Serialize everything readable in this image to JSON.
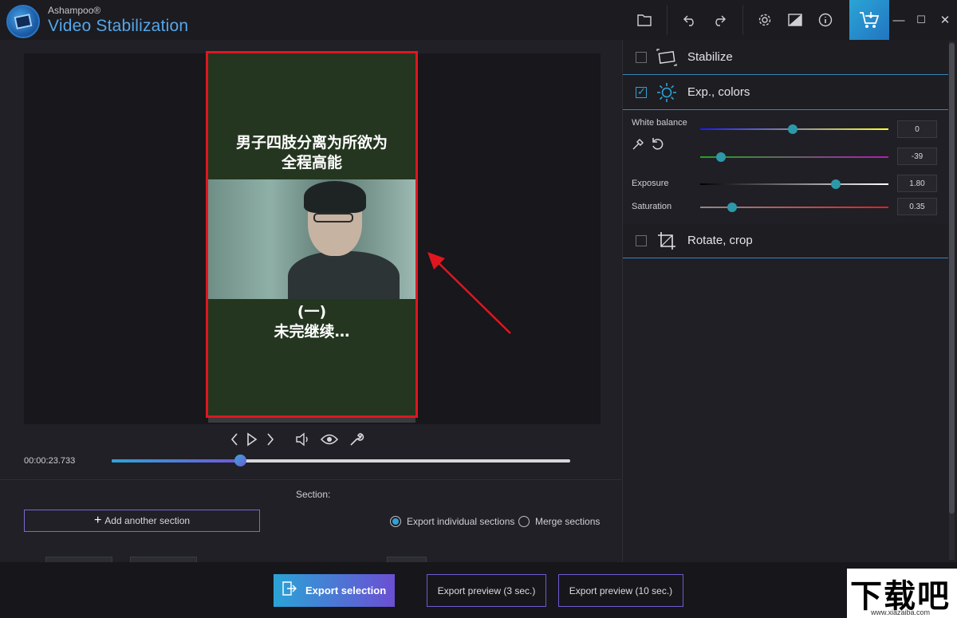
{
  "app": {
    "brand": "Ashampoo®",
    "name": "Video Stabilization"
  },
  "toolbar": {
    "icons": [
      "folder-icon",
      "undo-icon",
      "redo-icon",
      "settings-icon",
      "compare-icon",
      "info-icon",
      "cart-icon"
    ],
    "window_controls": [
      "—",
      "☐",
      "✕"
    ]
  },
  "video": {
    "caption_top_line1": "男子四肢分离为所欲为",
    "caption_top_line2": "全程高能",
    "caption_bottom_line1": "(一)",
    "caption_bottom_line2": "未完继续…",
    "highlight_color": "#e0161e"
  },
  "playback": {
    "time": "00:00:23.733",
    "progress": 0.28,
    "controls": [
      "prev-frame-icon",
      "play-icon",
      "next-frame-icon",
      "volume-icon",
      "eye-icon",
      "wrench-icon"
    ]
  },
  "section": {
    "label": "Section:",
    "add_button": "Add another section",
    "export_individual": "Export individual sections",
    "merge": "Merge sections",
    "selected": "export_individual"
  },
  "bottom": {
    "export_selection": "Export selection",
    "export_preview_3": "Export preview (3 sec.)",
    "export_preview_10": "Export preview (10 sec.)",
    "watermark_big": "下载吧",
    "watermark_small": "www.xiazaiba.com"
  },
  "panel": {
    "stabilize": {
      "title": "Stabilize",
      "checked": false
    },
    "exp_colors": {
      "title": "Exp., colors",
      "checked": true
    },
    "rotate_crop": {
      "title": "Rotate, crop",
      "checked": false
    },
    "white_balance_label": "White balance",
    "white_balance_1": {
      "value": "0",
      "level": 0.49
    },
    "white_balance_2": {
      "value": "-39",
      "level": 0.11
    },
    "exposure": {
      "label": "Exposure",
      "value": "1.80",
      "level": 0.72
    },
    "saturation": {
      "label": "Saturation",
      "value": "0.35",
      "level": 0.17
    }
  }
}
